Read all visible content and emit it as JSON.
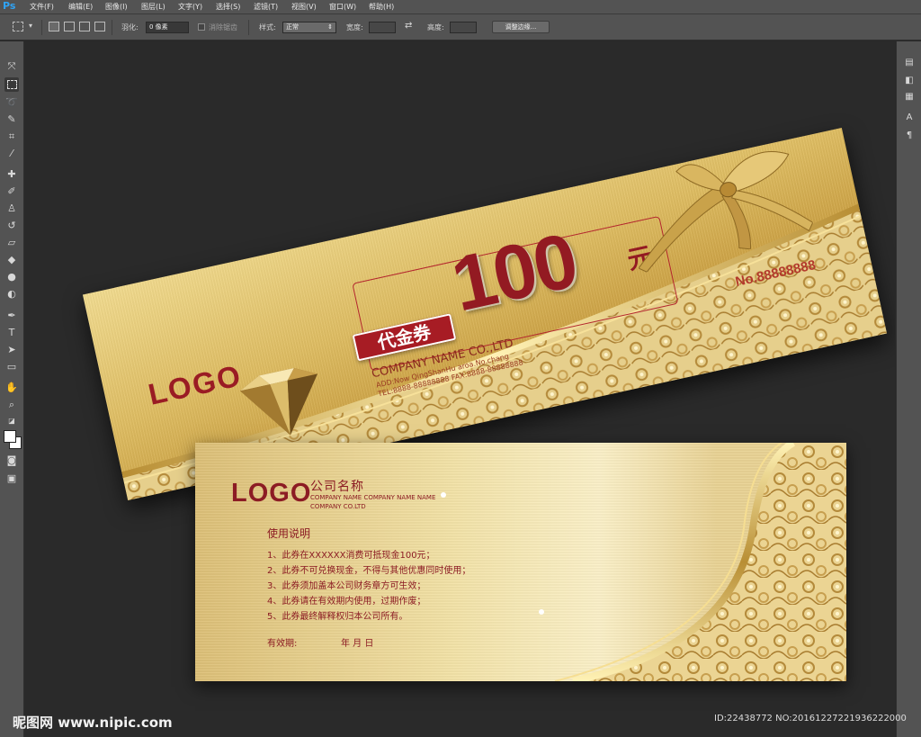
{
  "app": {
    "logo": "Ps",
    "menu": [
      "文件(F)",
      "编辑(E)",
      "图像(I)",
      "图层(L)",
      "文字(Y)",
      "选择(S)",
      "滤镜(T)",
      "视图(V)",
      "窗口(W)",
      "帮助(H)"
    ]
  },
  "options": {
    "feather_label": "羽化:",
    "feather_value": "0 像素",
    "antialias_label": "消除锯齿",
    "style_label": "样式:",
    "style_value": "正常",
    "width_label": "宽度:",
    "height_label": "高度:",
    "refine_button": "调整边缘..."
  },
  "voucher_front": {
    "logo": "LOGO",
    "badge": "代金券",
    "amount": "100",
    "unit": "元",
    "company": "COMPANY NAME CO.,LTD",
    "address": "ADD:Now QingShanHu aroa.No.chang",
    "tel": "TEL:8888-88888888  FAX:8888-88888888",
    "serial": "No.88888888"
  },
  "voucher_back": {
    "logo": "LOGO",
    "company_cn": "公司名称",
    "company_en": "COMPANY NAME COMPANY NAME NAME COMPANY CO.LTD",
    "rules_title": "使用说明",
    "rules": [
      "1、此券在XXXXXX消费可抵现金100元；",
      "2、此券不可兑换现金，不得与其他优惠同时使用；",
      "3、此券须加盖本公司财务章方可生效；",
      "4、此券请在有效期内使用，过期作废；",
      "5、此券最终解释权归本公司所有。"
    ],
    "valid_label": "有效期:",
    "valid_date": "年    月    日"
  },
  "watermark": {
    "left": "昵图网 www.nipic.com",
    "right": "ID:22438772 NO:20161227221936222000"
  },
  "colors": {
    "accent_red": "#931a22",
    "gold": "#d9b55a",
    "chrome": "#535353"
  }
}
